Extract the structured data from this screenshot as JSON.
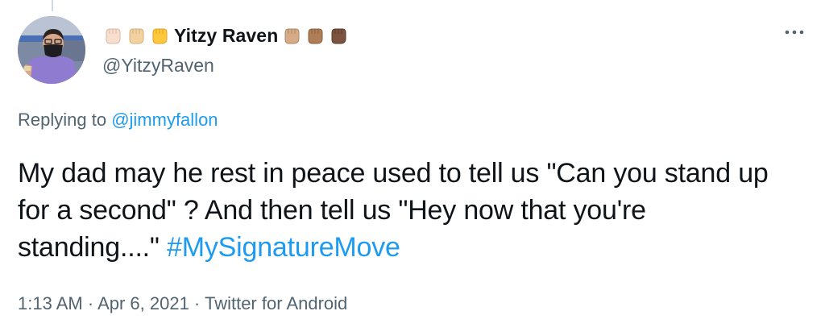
{
  "author": {
    "display_name": "Yitzy Raven",
    "handle": "@YitzyRaven",
    "name_prefix_emoji": [
      "raised-fist-light",
      "raised-fist-medium-light",
      "raised-fist-yellow"
    ],
    "name_suffix_emoji": [
      "raised-fist-medium",
      "raised-fist-medium-dark",
      "raised-fist-dark"
    ]
  },
  "reply": {
    "prefix": "Replying to ",
    "to_handle": "@jimmyfallon"
  },
  "tweet": {
    "text": "My dad may he rest in peace used to tell us \"Can you stand up for a second\" ? And then tell us \"Hey now that you're standing....\" ",
    "hashtag": "#MySignatureMove"
  },
  "meta": {
    "time": "1:13 AM",
    "separator": " · ",
    "date": "Apr 6, 2021",
    "source": "Twitter for Android"
  },
  "colors": {
    "link": "#1d9bf0",
    "secondary_text": "#536471",
    "primary_text": "#0f1419",
    "fist_light": "#f7dece",
    "fist_medium_light": "#f3d2a2",
    "fist_yellow": "#ffc83d",
    "fist_medium": "#d5ab88",
    "fist_medium_dark": "#af7e57",
    "fist_dark": "#7c533e"
  },
  "icons": {
    "more": "more-horizontal-icon"
  }
}
